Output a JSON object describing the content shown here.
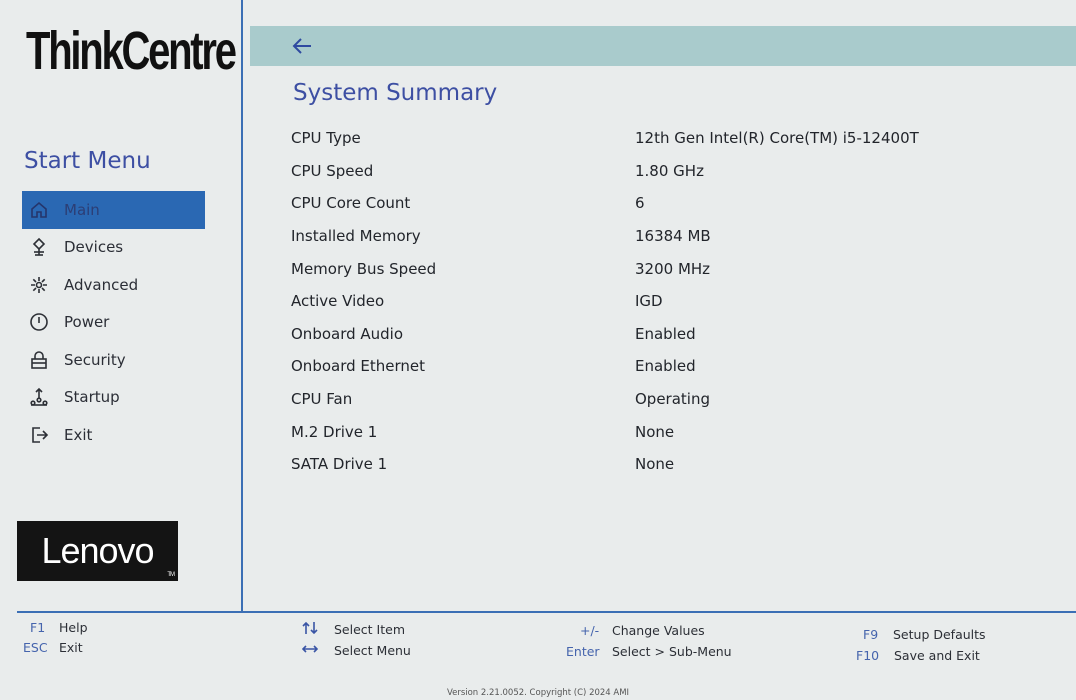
{
  "brand": "ThinkCentre",
  "sidebar": {
    "title": "Start Menu",
    "items": [
      {
        "label": "Main",
        "icon": "home-icon",
        "active": true
      },
      {
        "label": "Devices",
        "icon": "devices-icon"
      },
      {
        "label": "Advanced",
        "icon": "advanced-icon"
      },
      {
        "label": "Power",
        "icon": "power-icon"
      },
      {
        "label": "Security",
        "icon": "lock-icon"
      },
      {
        "label": "Startup",
        "icon": "startup-icon"
      },
      {
        "label": "Exit",
        "icon": "exit-icon"
      }
    ],
    "logo": "Lenovo",
    "logo_tm": "TM"
  },
  "main": {
    "title": "System Summary",
    "rows": [
      {
        "label": "CPU Type",
        "value": "12th Gen Intel(R) Core(TM) i5-12400T"
      },
      {
        "label": "CPU Speed",
        "value": "1.80 GHz"
      },
      {
        "label": "CPU Core Count",
        "value": "6"
      },
      {
        "label": "Installed Memory",
        "value": "16384 MB"
      },
      {
        "label": "Memory Bus Speed",
        "value": "3200 MHz"
      },
      {
        "label": "Active Video",
        "value": "IGD"
      },
      {
        "label": "Onboard Audio",
        "value": "Enabled"
      },
      {
        "label": "Onboard Ethernet",
        "value": "Enabled"
      },
      {
        "label": "CPU Fan",
        "value": "Operating"
      },
      {
        "label": "M.2 Drive 1",
        "value": "None"
      },
      {
        "label": "SATA Drive 1",
        "value": "None"
      }
    ]
  },
  "footer": {
    "f1": {
      "key": "F1",
      "desc": "Help"
    },
    "esc": {
      "key": "ESC",
      "desc": "Exit"
    },
    "select_item": {
      "key": "up-down-arrows-icon",
      "desc": "Select Item"
    },
    "select_menu": {
      "key": "left-right-arrows-icon",
      "desc": "Select Menu"
    },
    "change_values": {
      "key": "+/-",
      "desc": "Change Values"
    },
    "enter": {
      "key": "Enter",
      "desc": "Select > Sub-Menu"
    },
    "f9": {
      "key": "F9",
      "desc": "Setup Defaults"
    },
    "f10": {
      "key": "F10",
      "desc": "Save and Exit"
    }
  },
  "version": "Version 2.21.0052. Copyright (C) 2024 AMI",
  "colors": {
    "accent": "#3d4fa3",
    "active_bg": "#2a68b3",
    "topbar": "#a9cbcc",
    "divider": "#3b6fb5",
    "background": "#e9ecec"
  }
}
